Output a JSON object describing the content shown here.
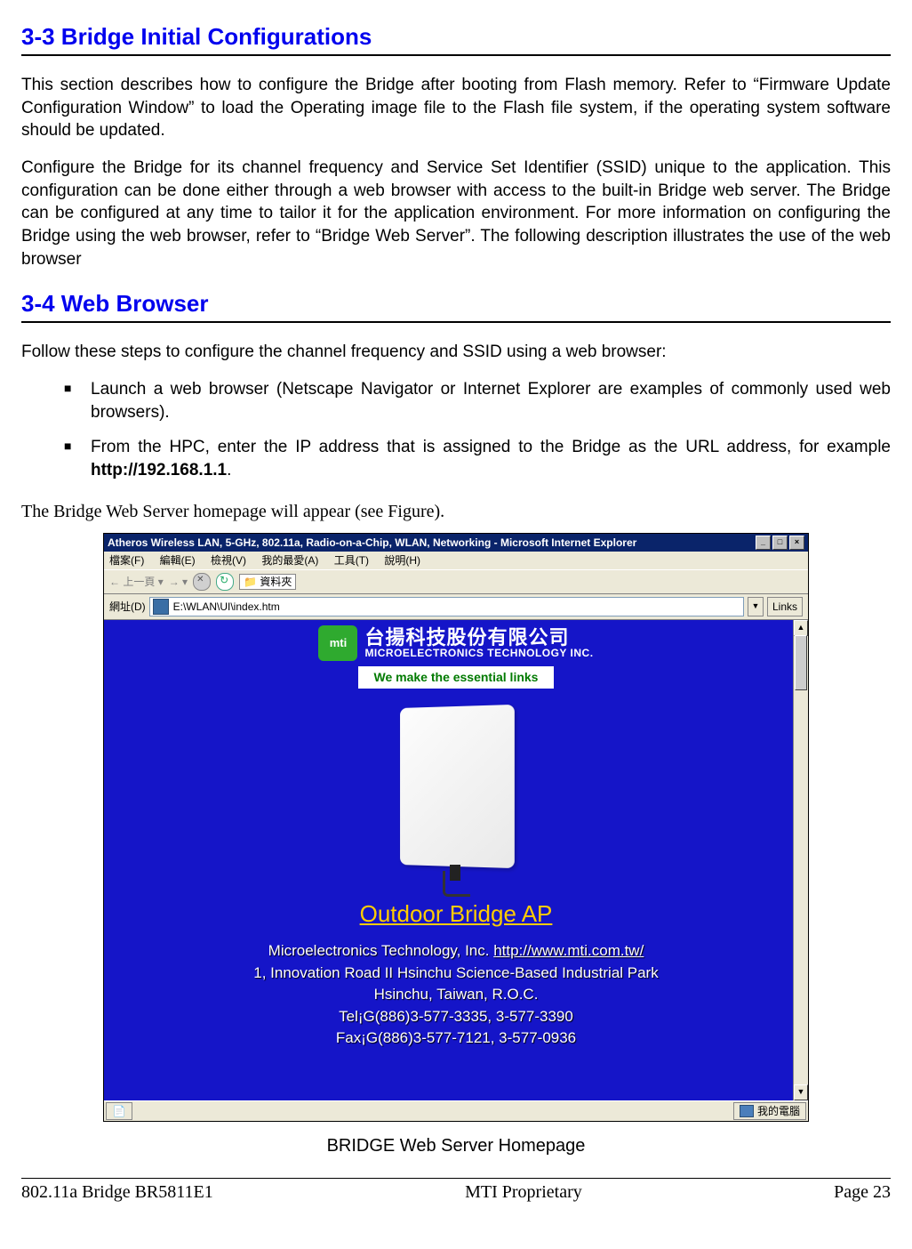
{
  "headings": {
    "h1": "3-3 Bridge Initial Configurations",
    "h2": "3-4 Web Browser"
  },
  "paragraphs": {
    "p1": "This section describes how to configure the Bridge after booting from Flash memory. Refer to “Firmware Update Configuration Window”  to load the Operating image file to the Flash file system, if the operating system software should be updated.",
    "p2": "Configure the Bridge for its channel frequency and Service Set Identifier (SSID) unique to the application. This configuration can be done either through a web browser with access to the built-in Bridge web server. The Bridge can be configured at any time to tailor it for the application environment. For more information on configuring the Bridge using the web browser, refer to  “Bridge Web Server”. The following description illustrates the use of the web browser",
    "p3": "Follow these steps to configure the channel frequency and SSID using a web browser:",
    "b1": "Launch a web browser (Netscape Navigator or Internet Explorer are examples of commonly used web browsers).",
    "b2_pre": "From the HPC, enter the IP address that is assigned to the Bridge as the URL address, for example ",
    "b2_bold": "http://192.168.1.1",
    "b2_post": ".",
    "p4": "The Bridge Web Server homepage will appear (see Figure)."
  },
  "browser": {
    "title": "Atheros Wireless LAN, 5-GHz, 802.11a, Radio-on-a-Chip, WLAN, Networking - Microsoft Internet Explorer",
    "menu": {
      "file": "檔案(F)",
      "edit": "編輯(E)",
      "view": "檢視(V)",
      "fav": "我的最愛(A)",
      "tools": "工具(T)",
      "help": "說明(H)"
    },
    "toolbar": {
      "back": "上一頁",
      "folders": "資料夾"
    },
    "address": {
      "label": "網址(D)",
      "value": "E:\\WLAN\\UI\\index.htm",
      "links": "Links"
    },
    "win_buttons": {
      "min": "_",
      "max": "□",
      "close": "×"
    },
    "statusbar": {
      "zone": "我的電腦"
    }
  },
  "homepage": {
    "logo_badge": "mti",
    "logo_cn": "台揚科技股份有限公司",
    "logo_en": "MICROELECTRONICS TECHNOLOGY INC.",
    "tagline": "We make the essential links",
    "main_link": "Outdoor Bridge AP",
    "company": "Microelectronics Technology, Inc. ",
    "company_url": "http://www.mti.com.tw/",
    "addr1": "1, Innovation Road II Hsinchu Science-Based Industrial Park",
    "addr2": "Hsinchu, Taiwan, R.O.C.",
    "tel": "Tel¡G(886)3-577-3335, 3-577-3390",
    "fax": "Fax¡G(886)3-577-7121, 3-577-0936"
  },
  "caption": "BRIDGE Web Server Homepage",
  "footer": {
    "left": "802.11a Bridge BR5811E1",
    "center": "MTI Proprietary",
    "right": "Page 23"
  }
}
